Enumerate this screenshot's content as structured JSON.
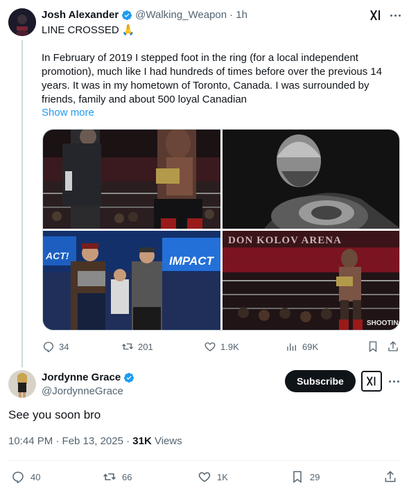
{
  "quoted_post": {
    "author_name": "Josh Alexander",
    "handle": "@Walking_Weapon",
    "time": "· 1h",
    "headline": "LINE CROSSED 🙏",
    "body": "In February of 2019 I stepped foot in the ring (for a local independent promotion), much like I had hundreds of times before over the previous 14 years. It was in my hometown of Toronto, Canada. I was surrounded by friends, family and about 500 loyal Canadian",
    "show_more": "Show more",
    "media_labels": {
      "arena_banner": "DON KOLOV ARENA",
      "impact_logo_left": "ACT!",
      "impact_logo_right": "IMPACT",
      "watermark": "SHOOTING"
    },
    "stats": {
      "replies": "34",
      "reposts": "201",
      "likes": "1.9K",
      "views": "69K"
    }
  },
  "reply_post": {
    "author_name": "Jordynne Grace",
    "handle": "@JordynneGrace",
    "subscribe_label": "Subscribe",
    "body": "See you soon bro",
    "timestamp": "10:44 PM · Feb 13, 2025 ·",
    "views_count": "31K",
    "views_label": "Views",
    "stats": {
      "replies": "40",
      "reposts": "66",
      "likes": "1K",
      "bookmarks": "29"
    }
  },
  "colors": {
    "accent": "#1d9bf0",
    "text": "#0f1419",
    "muted": "#536471",
    "verified": "#1d9bf0"
  }
}
